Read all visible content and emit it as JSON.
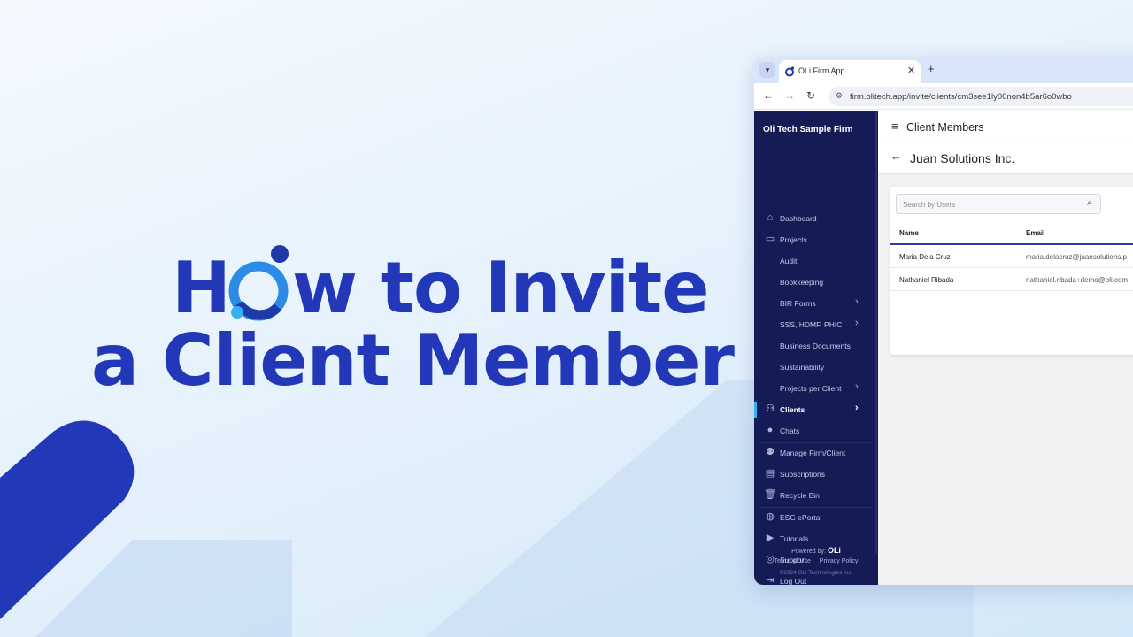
{
  "hero": {
    "line1_prefix": "H",
    "line1_suffix": "w to Invite",
    "line2": "a Client Member",
    "title_color": "#2338b8",
    "logo_icon": "oli-ring-logo-icon"
  },
  "browser": {
    "tab_title": "OLi Firm App",
    "url": "firm.olitech.app/invite/clients/cm3see1ly00non4b5ar6o0wbo"
  },
  "sidebar": {
    "firm_name": "Oli Tech Sample Firm",
    "items": [
      {
        "label": "Dashboard",
        "icon": "home-icon"
      },
      {
        "label": "Projects",
        "icon": "briefcase-icon"
      },
      {
        "label": "Audit"
      },
      {
        "label": "Bookkeeping"
      },
      {
        "label": "BIR Forms"
      },
      {
        "label": "SSS, HDMF, PHIC"
      },
      {
        "label": "Business Documents"
      },
      {
        "label": "Sustainability"
      },
      {
        "label": "Projects per Client"
      },
      {
        "label": "Clients",
        "icon": "users-icon",
        "active": true
      },
      {
        "label": "Chats",
        "icon": "chat-icon"
      },
      {
        "label": "Manage Firm/Client",
        "icon": "user-settings-icon"
      },
      {
        "label": "Subscriptions",
        "icon": "receipt-icon"
      },
      {
        "label": "Recycle Bin",
        "icon": "trash-icon"
      },
      {
        "label": "ESG ePortal",
        "icon": "globe-icon"
      },
      {
        "label": "Tutorials",
        "icon": "video-icon"
      },
      {
        "label": "Support",
        "icon": "lifebuoy-icon"
      },
      {
        "label": "Log Out",
        "icon": "logout-icon"
      }
    ],
    "powered_by": "Powered by:",
    "powered_logo": "OLi",
    "terms": "Terms of Use",
    "privacy": "Privacy Policy",
    "copyright": "©2024 OLi Technologies Inc."
  },
  "main": {
    "header_title": "Client Members",
    "client_name": "Juan Solutions Inc.",
    "search_placeholder": "Search by Users",
    "columns": [
      "Name",
      "Email"
    ],
    "rows": [
      {
        "name": "Maria Dela Cruz",
        "email": "maria.delacruz@juansolutions.p"
      },
      {
        "name": "Nathaniel Ribada",
        "email": "nathaniel.ribada+demo@oli.com"
      }
    ]
  },
  "colors": {
    "sidebar_bg": "#151c55",
    "accent": "#2338b8",
    "active_indicator": "#37b1f5"
  }
}
